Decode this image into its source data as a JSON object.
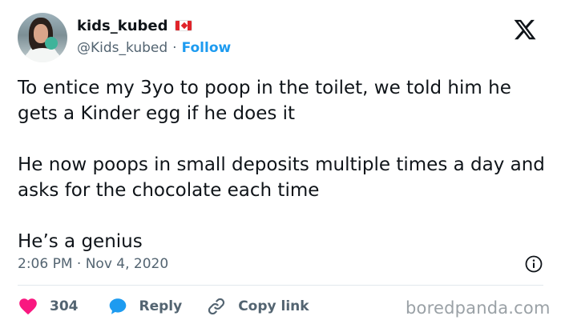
{
  "user": {
    "display_name": "kids_kubed",
    "handle": "@Kids_kubed",
    "separator": "·",
    "follow_label": "Follow",
    "flag_icon": "canada-flag-icon"
  },
  "header": {
    "logo_icon": "x-logo-icon"
  },
  "tweet": {
    "paragraphs": [
      "To entice my 3yo to poop in the toilet, we told him he gets a Kinder egg if he does it",
      "He now poops in small deposits multiple times a day and asks for the chocolate each time",
      "He’s a genius"
    ],
    "timestamp": "2:06 PM · Nov 4, 2020",
    "info_icon": "info-icon"
  },
  "actions": {
    "like_count": "304",
    "reply_label": "Reply",
    "copy_link_label": "Copy link"
  },
  "colors": {
    "accent": "#1d9bf0",
    "like": "#f91880",
    "text": "#0f1419",
    "secondary": "#536471",
    "flag_red": "#e0242a"
  },
  "watermark": {
    "text": "boredpanda.com"
  }
}
